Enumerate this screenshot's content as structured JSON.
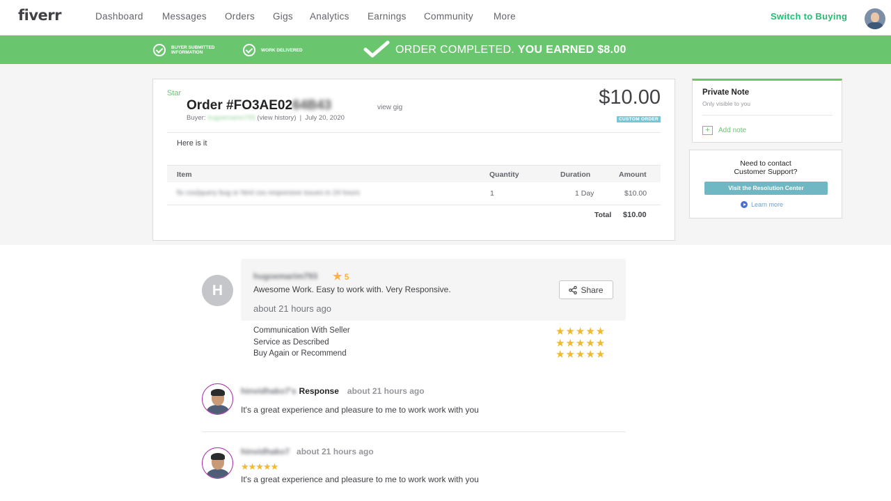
{
  "nav": {
    "logo": "fiverr",
    "items": [
      "Dashboard",
      "Messages",
      "Orders",
      "Gigs",
      "Analytics",
      "Earnings",
      "Community",
      "More"
    ],
    "switch": "Switch to Buying"
  },
  "banner": {
    "step1": "BUYER SUBMITTED INFORMATION",
    "step2": "WORK DELIVERED",
    "completed": "ORDER COMPLETED.",
    "earned": "YOU EARNED $8.00",
    "color": "#6ac56f"
  },
  "order": {
    "star_label": "Star",
    "title_visible": "Order #FO3AE02",
    "title_blurred": "64B43",
    "view_gig": "view gig",
    "buyer_label": "Buyer:",
    "buyer_name": "hugoemarim793",
    "view_history": "(view history)",
    "date": "July 20, 2020",
    "price": "$10.00",
    "badge": "CUSTOM ORDER",
    "message": "Here is it",
    "table": {
      "headers": [
        "Item",
        "Quantity",
        "Duration",
        "Amount"
      ],
      "row": {
        "item": "fix css/jquery bug or html css responsive issues in 24 hours",
        "quantity": "1",
        "duration": "1 Day",
        "amount": "$10.00"
      },
      "total_label": "Total",
      "total_value": "$10.00"
    }
  },
  "private_note": {
    "title": "Private Note",
    "subtitle": "Only visible to you",
    "add": "Add note"
  },
  "support": {
    "line1": "Need to contact",
    "line2": "Customer Support?",
    "button": "Visit the Resolution Center",
    "learn": "Learn more"
  },
  "review": {
    "avatar_letter": "H",
    "user": "hugoemarim793",
    "rating": "5",
    "text": "Awesome Work. Easy to work with. Very Responsive.",
    "time": "about 21 hours ago",
    "share": "Share",
    "criteria": [
      {
        "label": "Communication With Seller",
        "stars": 5
      },
      {
        "label": "Service as Described",
        "stars": 5
      },
      {
        "label": "Buy Again or Recommend",
        "stars": 5
      }
    ]
  },
  "response": {
    "seller": "hinvidhako7's",
    "label": "Response",
    "time": "about 21 hours ago",
    "text": "It's a great experience and pleasure to me to work work with you"
  },
  "seller_review": {
    "seller": "hinvidhako7",
    "time": "about 21 hours ago",
    "stars": 5,
    "text": "It's a great experience and pleasure to me to work work with you"
  }
}
